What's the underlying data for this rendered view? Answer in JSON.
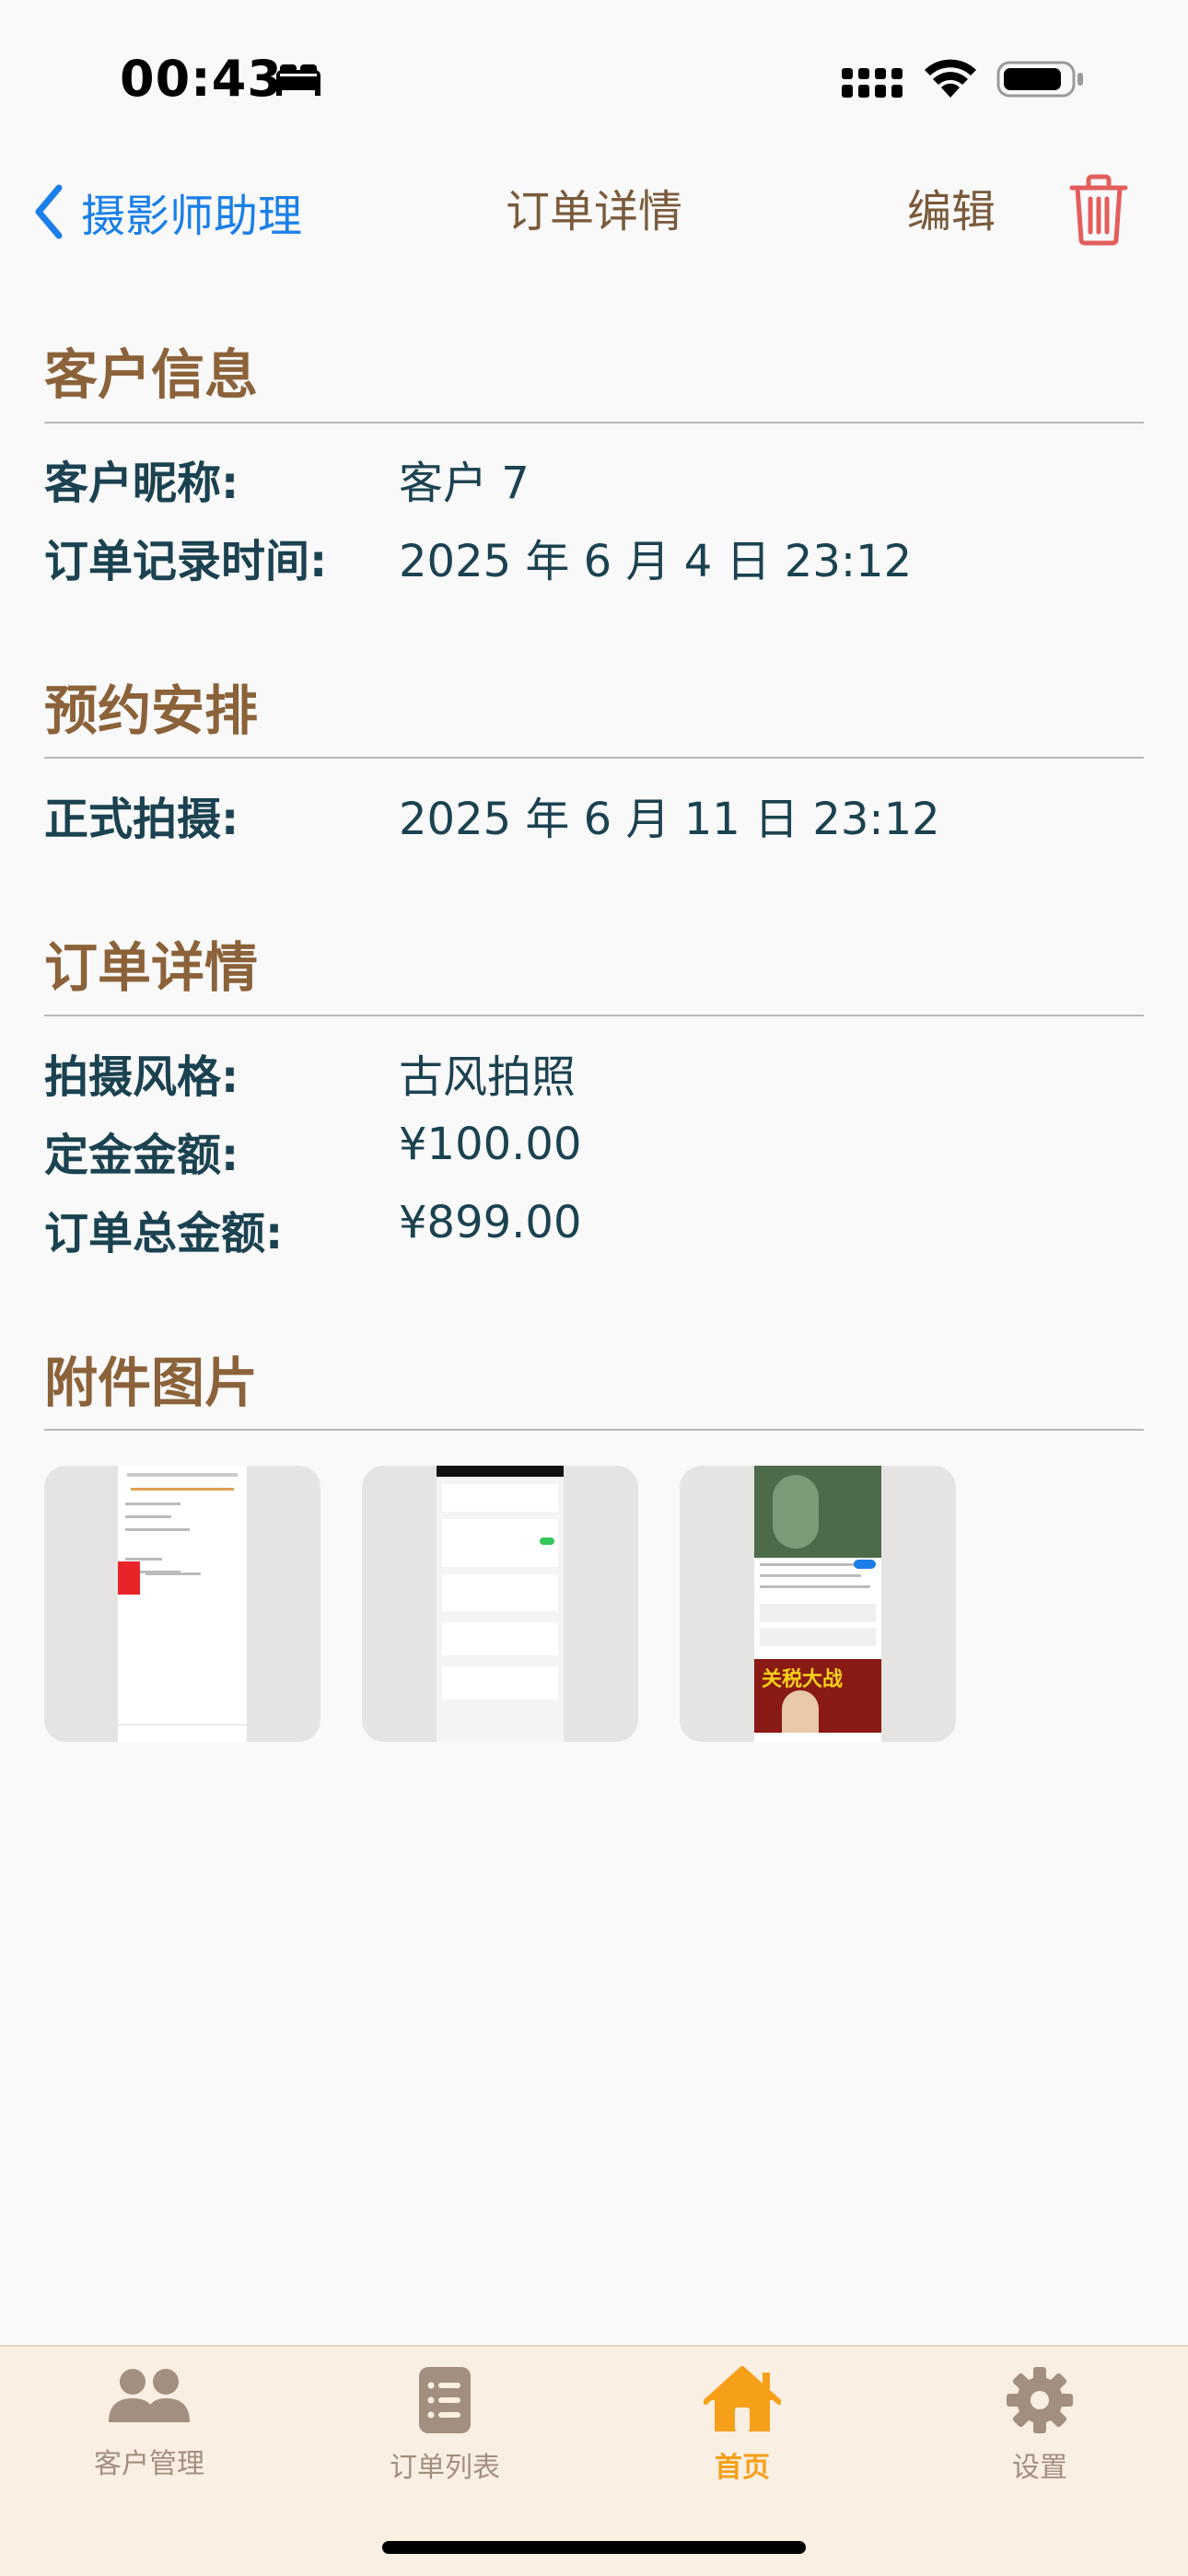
{
  "status_bar": {
    "time": "00:43",
    "icons": [
      "sleep-focus-icon",
      "cellular-signal-icon",
      "wifi-icon",
      "battery-icon"
    ]
  },
  "nav": {
    "back_label": "摄影师助理",
    "title": "订单详情",
    "edit_label": "编辑",
    "delete_icon": "trash-icon"
  },
  "sections": {
    "customer": {
      "title": "客户信息",
      "rows": [
        {
          "label": "客户昵称:",
          "value": "客户 7"
        },
        {
          "label": "订单记录时间:",
          "value": "2025 年 6 月 4 日 23:12"
        }
      ]
    },
    "schedule": {
      "title": "预约安排",
      "rows": [
        {
          "label": "正式拍摄:",
          "value": "2025 年 6 月 11 日 23:12"
        }
      ]
    },
    "order": {
      "title": "订单详情",
      "rows": [
        {
          "label": "拍摄风格:",
          "value": "古风拍照"
        },
        {
          "label": "定金金额:",
          "value": "¥100.00"
        },
        {
          "label": "订单总金额:",
          "value": "¥899.00"
        }
      ]
    },
    "attachments": {
      "title": "附件图片",
      "images": [
        "attachment-screenshot-1",
        "attachment-screenshot-2",
        "attachment-screenshot-3"
      ],
      "image3_caption": "关税大战"
    }
  },
  "tabbar": {
    "tabs": [
      {
        "label": "客户管理",
        "icon": "people-icon",
        "active": false
      },
      {
        "label": "订单列表",
        "icon": "list-icon",
        "active": false
      },
      {
        "label": "首页",
        "icon": "home-icon",
        "active": true
      },
      {
        "label": "设置",
        "icon": "gear-icon",
        "active": false
      }
    ]
  },
  "colors": {
    "accent_brown": "#8b6239",
    "value_teal": "#1b4250",
    "link_blue": "#1a7fe8",
    "active_tab": "#f6a01a",
    "inactive_tab": "#a28f80",
    "delete_red": "#e35d5d"
  }
}
